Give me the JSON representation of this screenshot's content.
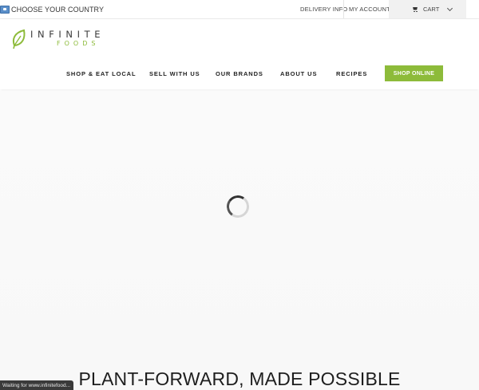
{
  "topbar": {
    "country_label": "CHOOSE YOUR COUNTRY",
    "delivery_label": "DELIVERY INFO",
    "account_label": "MY ACCOUNT",
    "cart_label": "CART"
  },
  "logo": {
    "word": "INFINITE",
    "sub": "FOODS",
    "colors": {
      "text": "#3a3a3a",
      "accent": "#8dbb3a"
    }
  },
  "nav": {
    "items": [
      {
        "label": "SHOP & EAT LOCAL"
      },
      {
        "label": "SELL WITH US"
      },
      {
        "label": "OUR BRANDS"
      },
      {
        "label": "ABOUT US"
      },
      {
        "label": "RECIPES"
      }
    ],
    "cta_label": "SHOP ONLINE",
    "cta_color": "#8dbb3a"
  },
  "hero": {
    "headline": "PLANT-FORWARD, MADE POSSIBLE",
    "loading": true
  },
  "status_bar": {
    "text": "Waiting for www.infinitefood..."
  },
  "icons": [
    "flag-icon",
    "cart-icon",
    "chevron-down-icon",
    "leaf-logo-icon",
    "loading-spinner-icon"
  ]
}
